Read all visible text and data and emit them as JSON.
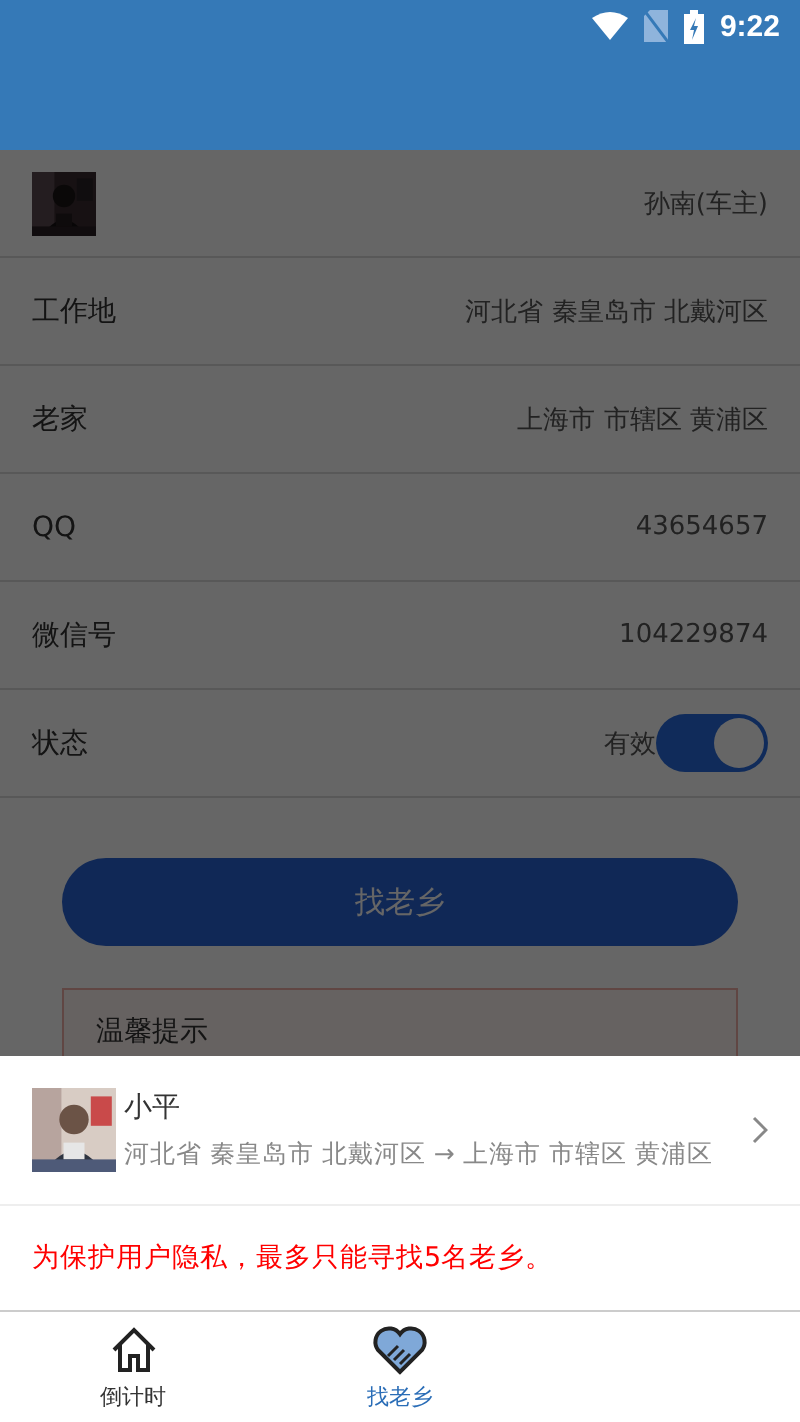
{
  "status_bar": {
    "time": "9:22"
  },
  "profile": {
    "name": "孙南(车主)"
  },
  "fields": [
    {
      "kind": "text",
      "label": "工作地",
      "value": "河北省 秦皇岛市 北戴河区"
    },
    {
      "kind": "text",
      "label": "老家",
      "value": "上海市 市辖区 黄浦区"
    },
    {
      "kind": "text",
      "label": "QQ",
      "value": "43654657"
    },
    {
      "kind": "text",
      "label": "微信号",
      "value": "104229874"
    },
    {
      "kind": "switch",
      "label": "状态",
      "value": "有效",
      "on": true
    }
  ],
  "find_button": "找老乡",
  "tip": {
    "title": "温馨提示"
  },
  "sheet": {
    "match": {
      "name": "小平",
      "route": "河北省 秦皇岛市 北戴河区 → 上海市 市辖区 黄浦区"
    },
    "notice": "为保护用户隐私，最多只能寻找5名老乡。"
  },
  "nav": [
    {
      "label": "倒计时",
      "kind": "home",
      "selected": false
    },
    {
      "label": "找老乡",
      "kind": "match",
      "selected": true
    }
  ]
}
